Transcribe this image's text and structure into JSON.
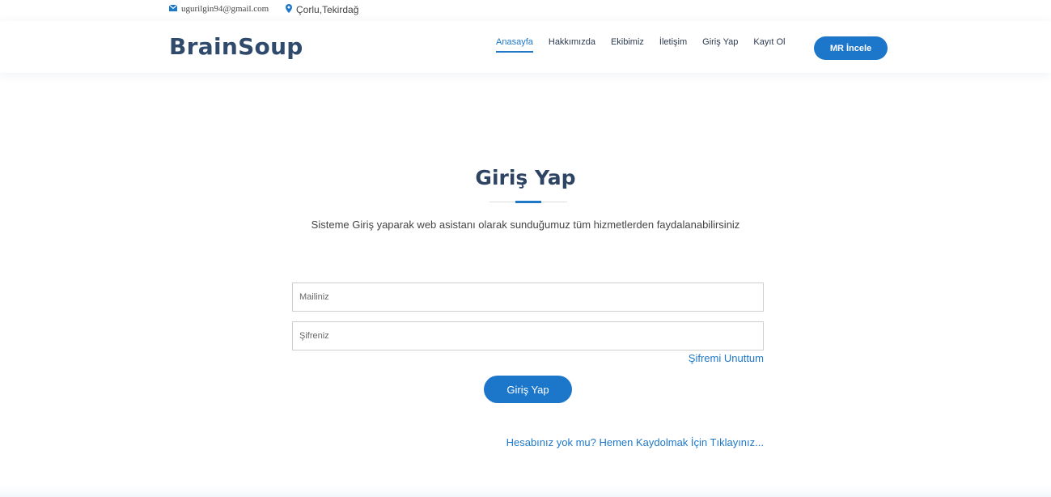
{
  "topbar": {
    "email": "ugurilgin94@gmail.com",
    "email_icon": "envelope-icon",
    "location": "Çorlu,Tekirdağ",
    "location_icon": "map-pin-icon"
  },
  "header": {
    "logo": "BrainSoup",
    "nav": [
      "Anasayfa",
      "Hakkımızda",
      "Ekibimiz",
      "İletişim",
      "Giriş Yap",
      "Kayıt Ol"
    ],
    "active_nav": "Anasayfa",
    "cta_label": "MR İncele"
  },
  "main": {
    "title": "Giriş Yap",
    "subtitle": "Sisteme Giriş yaparak web asistanı olarak sunduğumuz tüm hizmetlerden faydalanabilirsiniz",
    "email_placeholder": "Mailiniz",
    "password_placeholder": "Şifreniz",
    "forgot_label": "Şifremi Unuttum",
    "submit_label": "Giriş Yap",
    "register_label": "Hesabınız yok mu? Hemen Kaydolmak İçin Tıklayınız..."
  },
  "colors": {
    "accent": "#1c76c9",
    "logo": "#2f4a6b",
    "title": "#2d4462"
  }
}
